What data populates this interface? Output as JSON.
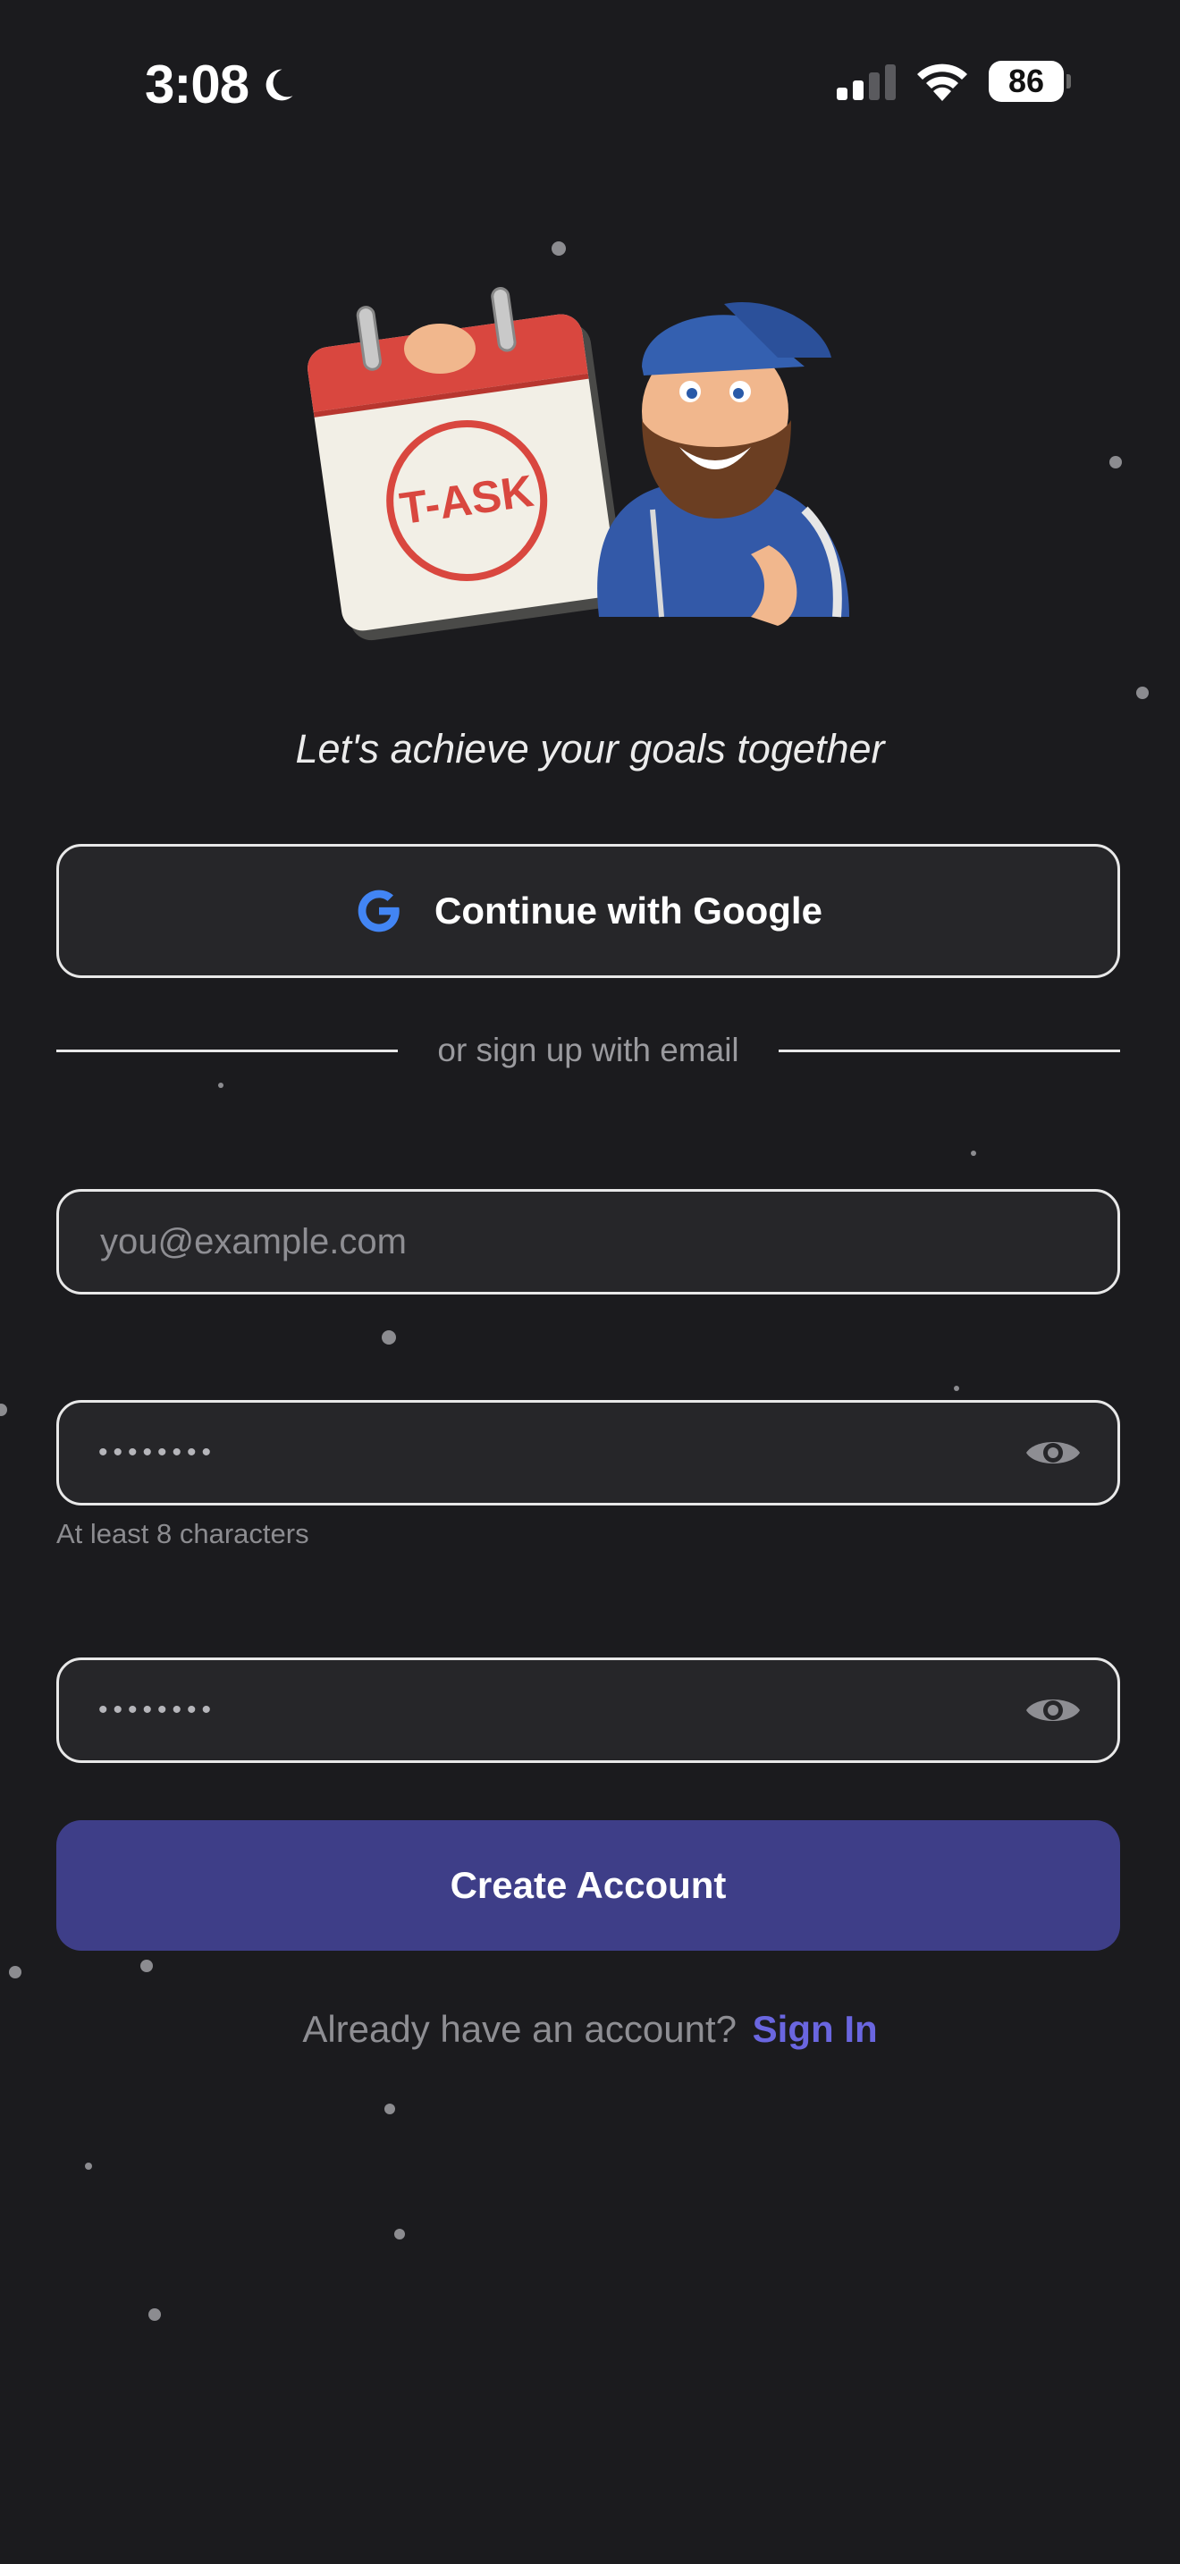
{
  "status_bar": {
    "time": "3:08",
    "battery": "86",
    "icons": [
      "moon-icon",
      "signal-icon",
      "wifi-icon",
      "battery-icon"
    ]
  },
  "hero": {
    "calendar_label": "T-ASK",
    "tagline": "Let's achieve your goals together"
  },
  "google_button": {
    "label": "Continue with Google",
    "icon": "google-icon"
  },
  "divider": {
    "text": "or sign up with email"
  },
  "form": {
    "email_placeholder": "you@example.com",
    "password_masked": "••••••••",
    "password_hint": "At least 8 characters",
    "confirm_masked": "••••••••"
  },
  "create_button": {
    "label": "Create Account"
  },
  "signin": {
    "prompt": "Already have an account?",
    "link": "Sign In"
  },
  "colors": {
    "background": "#1b1b1e",
    "field_bg": "#262629",
    "primary_button": "#3e3e88",
    "link": "#6a66e0"
  }
}
